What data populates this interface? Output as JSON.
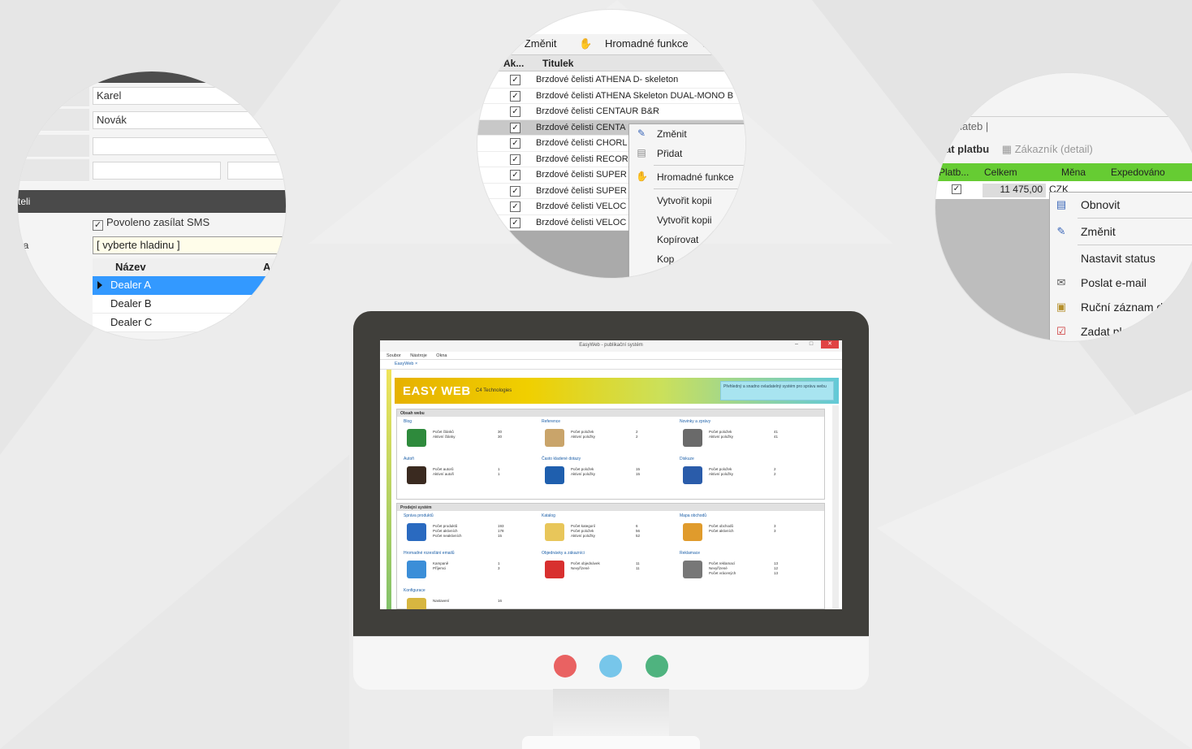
{
  "colors": {
    "background": "#ececec",
    "monitor": "#403f3b",
    "accent_blue": "#3399ff",
    "header_green": "#66cc33",
    "dot_red": "#e96262",
    "dot_blue": "#77c6ea",
    "dot_green": "#4fb37f"
  },
  "circle1": {
    "fields": [
      {
        "value": "Karel"
      },
      {
        "value": "Novák"
      },
      {
        "value": ""
      },
      {
        "value": ""
      }
    ],
    "section_label": "teli",
    "sms_checkbox": {
      "label": "Povoleno zasílat SMS",
      "checked": true
    },
    "select_label": "na",
    "select_value": "[ vyberte hladinu ]",
    "grid": {
      "header": "Název",
      "header2": "A",
      "rows": [
        "Dealer A",
        "Dealer B",
        "Dealer C"
      ]
    }
  },
  "circle2": {
    "toolbar": {
      "change": "Změnit",
      "bulk": "Hromadné funkce"
    },
    "columns": {
      "active": "Ak...",
      "title": "Titulek"
    },
    "rows": [
      "Brzdové čelisti ATHENA D- skeleton",
      "Brzdové čelisti ATHENA Skeleton DUAL-MONO B",
      "Brzdové čelisti CENTAUR B&R",
      "Brzdové čelisti CENTA",
      "Brzdové čelisti CHORL",
      "Brzdové čelisti RECOR",
      "Brzdové čelisti SUPER",
      "Brzdové čelisti SUPER",
      "Brzdové čelisti VELOC",
      "Brzdové čelisti VELOC"
    ],
    "context_menu": [
      "Změnit",
      "Přidat",
      "Hromadné funkce",
      "Vytvořit kopii",
      "Vytvořit kopii",
      "Kopírovat",
      "Kop"
    ]
  },
  "circle3": {
    "tab": "u plateb",
    "toolbar": {
      "pay": "at platbu",
      "customer": "Zákazník (detail)"
    },
    "columns": {
      "platb": "Platb...",
      "total": "Celkem",
      "currency": "Měna",
      "shipped": "Expedováno"
    },
    "row": {
      "total": "11 475,00",
      "currency": "CZK"
    },
    "context_menu": [
      "Obnovit",
      "Změnit",
      "Nastavit status",
      "Poslat e-mail",
      "Ruční záznam d",
      "Zadat pla"
    ]
  },
  "screen": {
    "window_title": "EasyWeb - publikační systém",
    "menubar": [
      "Soubor",
      "Nástroje",
      "Okna"
    ],
    "tab": "EasyWeb",
    "logo": "EASY WEB",
    "logo_sub": "C4 Technologies",
    "banner_text": "Přehledný a snadno ovladatelný systém pro správu webu",
    "sections": [
      {
        "title": "Obsah webu",
        "items": [
          {
            "name": "Blog",
            "lines": [
              "Počet článků",
              "Aktivní články"
            ],
            "nums": [
              "30",
              "30"
            ],
            "icon": "folder-icon"
          },
          {
            "name": "Reference",
            "lines": [
              "Počet položek",
              "Aktivní položky"
            ],
            "nums": [
              "2",
              "2"
            ],
            "icon": "book-icon"
          },
          {
            "name": "Novinky a zprávy",
            "lines": [
              "Počet položek",
              "Aktivní položky"
            ],
            "nums": [
              "41",
              "41"
            ],
            "icon": "newspaper-icon"
          },
          {
            "name": "Autoři",
            "lines": [
              "Počet autorů",
              "Aktivní autoři"
            ],
            "nums": [
              "1",
              "1"
            ],
            "icon": "people-icon"
          },
          {
            "name": "Často kladené dotazy",
            "lines": [
              "Počet položek",
              "Aktivní položky"
            ],
            "nums": [
              "15",
              "15"
            ],
            "icon": "info-icon"
          },
          {
            "name": "Diskuze",
            "lines": [
              "Počet položek",
              "Aktivní položky"
            ],
            "nums": [
              "2",
              "2"
            ],
            "icon": "pen-icon"
          }
        ]
      },
      {
        "title": "Prodejní systém",
        "items": [
          {
            "name": "Správa produktů",
            "lines": [
              "Počet produktů",
              "Počet aktivních",
              "Počet neaktivních"
            ],
            "nums": [
              "193",
              "178",
              "15"
            ],
            "icon": "edit-icon"
          },
          {
            "name": "Katalog",
            "lines": [
              "Počet kategorií",
              "Počet položek",
              "Aktivní položky"
            ],
            "nums": [
              "6",
              "56",
              "52"
            ],
            "icon": "catalog-icon"
          },
          {
            "name": "Mapa obchodů",
            "lines": [
              "Počet obchodů",
              "Počet aktivních"
            ],
            "nums": [
              "3",
              "3"
            ],
            "icon": "map-icon"
          },
          {
            "name": "Hromadné rozesílání emailů",
            "lines": [
              "Kampaně",
              "Příjemci"
            ],
            "nums": [
              "1",
              "3"
            ],
            "icon": "mail-icon"
          },
          {
            "name": "Objednávky a zákazníci",
            "lines": [
              "Počet objednávek",
              "Nevyřízené"
            ],
            "nums": [
              "11",
              "11"
            ],
            "icon": "order-icon"
          },
          {
            "name": "Reklamace",
            "lines": [
              "Počet reklamací",
              "Nevyřízené",
              "Počet vrácených"
            ],
            "nums": [
              "13",
              "12",
              "13"
            ],
            "icon": "return-icon"
          },
          {
            "name": "Konfigurace",
            "lines": [
              "Nastavení"
            ],
            "nums": [
              "16"
            ],
            "icon": "config-icon"
          }
        ]
      }
    ]
  }
}
